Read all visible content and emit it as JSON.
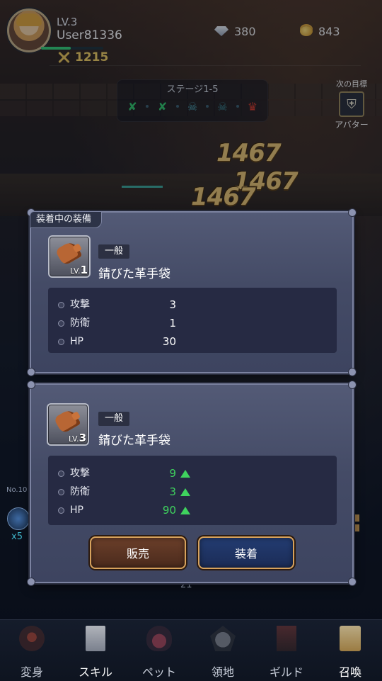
{
  "hud": {
    "level": "LV.3",
    "username": "User81336",
    "xp_fraction": 0.48,
    "power": "1215",
    "gems": "380",
    "gold": "843"
  },
  "stage": {
    "title": "ステージ1-5"
  },
  "next_target": {
    "label": "次の目標",
    "name": "アバター"
  },
  "damage": [
    "1467",
    "1467",
    "1467"
  ],
  "equipped": {
    "tab": "装着中の装備",
    "rarity": "一般",
    "level_prefix": "LV.",
    "level": "1",
    "name": "錆びた革手袋",
    "stats": [
      {
        "name": "攻撃",
        "value": "3"
      },
      {
        "name": "防衛",
        "value": "1"
      },
      {
        "name": "HP",
        "value": "30"
      }
    ]
  },
  "candidate": {
    "rarity": "一般",
    "level_prefix": "LV.",
    "level": "3",
    "name": "錆びた革手袋",
    "stats": [
      {
        "name": "攻撃",
        "value": "9"
      },
      {
        "name": "防衛",
        "value": "3"
      },
      {
        "name": "HP",
        "value": "90"
      }
    ],
    "sell_label": "販売",
    "equip_label": "装着"
  },
  "side": {
    "number": "No.10",
    "multiplier": "x5",
    "counter": "21"
  },
  "nav": [
    {
      "label": "変身",
      "icon": "transform-icon"
    },
    {
      "label": "スキル",
      "icon": "skill-book-icon"
    },
    {
      "label": "ペット",
      "icon": "pet-paw-icon"
    },
    {
      "label": "領地",
      "icon": "territory-icon"
    },
    {
      "label": "ギルド",
      "icon": "guild-banner-icon"
    },
    {
      "label": "召喚",
      "icon": "summon-card-icon"
    }
  ],
  "colors": {
    "stat_up": "#3fd35e",
    "power": "#f2cf63",
    "damage": "#e8c373"
  }
}
